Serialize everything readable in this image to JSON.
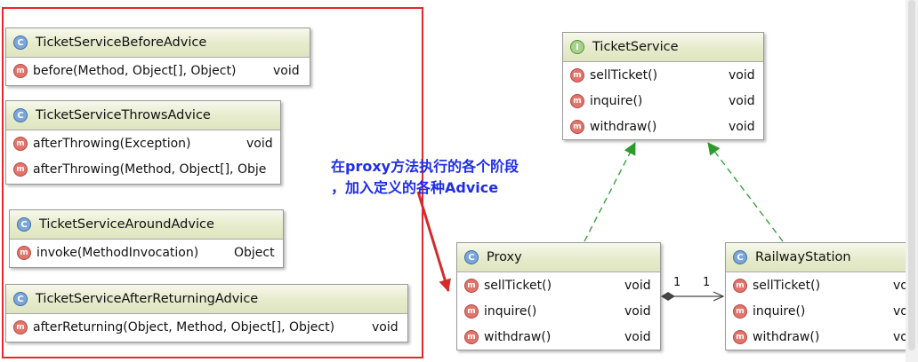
{
  "annotation": {
    "line1": "在proxy方法执行的各个阶段",
    "line2": "，加入定义的各种Advice"
  },
  "classes": [
    {
      "key": "before",
      "name": "TicketServiceBeforeAdvice",
      "kind": "class",
      "badge": "C",
      "methods": [
        {
          "sig": "before(Method, Object[], Object)",
          "ret": "void"
        }
      ]
    },
    {
      "key": "throws",
      "name": "TicketServiceThrowsAdvice",
      "kind": "class",
      "badge": "C",
      "methods": [
        {
          "sig": "afterThrowing(Exception)",
          "ret": "void"
        },
        {
          "sig": "afterThrowing(Method, Object[], Obje",
          "ret": ""
        }
      ]
    },
    {
      "key": "around",
      "name": "TicketServiceAroundAdvice",
      "kind": "class",
      "badge": "C",
      "methods": [
        {
          "sig": "invoke(MethodInvocation)",
          "ret": "Object"
        }
      ]
    },
    {
      "key": "afterret",
      "name": "TicketServiceAfterReturningAdvice",
      "kind": "class",
      "badge": "C",
      "methods": [
        {
          "sig": "afterReturning(Object, Method, Object[], Object)",
          "ret": "void"
        }
      ]
    },
    {
      "key": "ticketservice",
      "name": "TicketService",
      "kind": "interface",
      "badge": "I",
      "methods": [
        {
          "sig": "sellTicket()",
          "ret": "void"
        },
        {
          "sig": "inquire()",
          "ret": "void"
        },
        {
          "sig": "withdraw()",
          "ret": "void"
        }
      ]
    },
    {
      "key": "proxy",
      "name": "Proxy",
      "kind": "class",
      "badge": "C",
      "methods": [
        {
          "sig": "sellTicket()",
          "ret": "void"
        },
        {
          "sig": "inquire()",
          "ret": "void"
        },
        {
          "sig": "withdraw()",
          "ret": "void"
        }
      ]
    },
    {
      "key": "railway",
      "name": "RailwayStation",
      "kind": "class",
      "badge": "C",
      "methods": [
        {
          "sig": "sellTicket()",
          "ret": "vo"
        },
        {
          "sig": "inquire()",
          "ret": "vo"
        },
        {
          "sig": "withdraw()",
          "ret": "vo"
        }
      ]
    }
  ],
  "method_badge": "m",
  "association": {
    "source_multiplicity": "1",
    "target_multiplicity": "1"
  },
  "colors": {
    "frame": "#e8262b",
    "annotation": "#1f2ee6",
    "realization": "#2e9a2e",
    "arrow": "#d22b2b"
  }
}
